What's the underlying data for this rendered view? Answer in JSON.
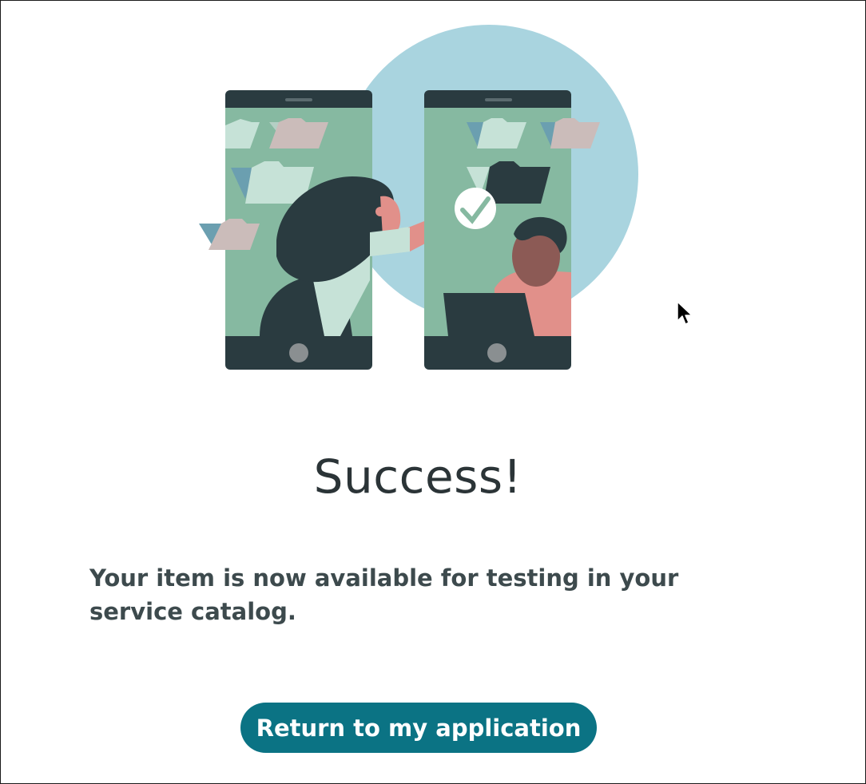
{
  "success_page": {
    "title": "Success!",
    "message": "Your item is now available for testing in your service catalog.",
    "return_button_label": "Return to my application"
  },
  "colors": {
    "accent": "#0b7384",
    "title_text": "#2b3437",
    "body_text": "#3d4a4d",
    "phone_frame": "#2a3b40",
    "phone_screen": "#86b9a1",
    "circle_bg": "#a9d4df"
  }
}
